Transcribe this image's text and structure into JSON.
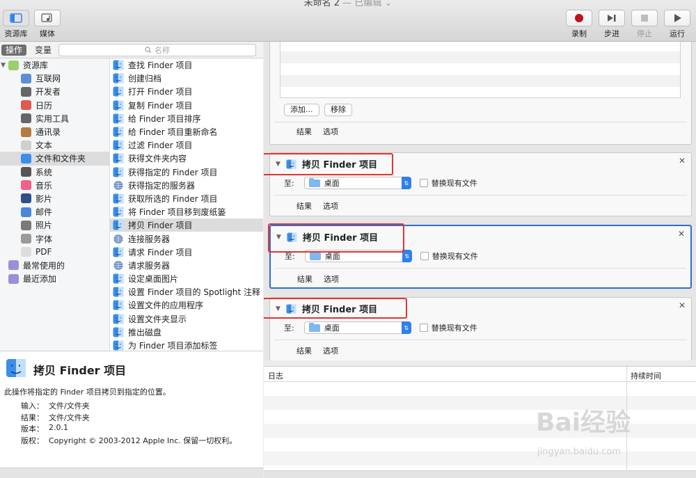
{
  "window": {
    "title": "未命名 2",
    "edited": "— 已编辑",
    "dropdown": "⌄"
  },
  "toolbar": {
    "library_label": "资源库",
    "media_label": "媒体",
    "record_label": "录制",
    "step_label": "步进",
    "stop_label": "停止",
    "run_label": "运行"
  },
  "left": {
    "tab_actions": "操作",
    "tab_variables": "变量",
    "search_placeholder": "名称"
  },
  "library": [
    {
      "label": "资源库",
      "icon": "library-icon",
      "color": "#9ad06a",
      "indent": 0,
      "disclosure": "▼"
    },
    {
      "label": "互联网",
      "icon": "globe-icon",
      "color": "#5b8fd6",
      "indent": 1
    },
    {
      "label": "开发者",
      "icon": "tools-icon",
      "color": "#666666",
      "indent": 1
    },
    {
      "label": "日历",
      "icon": "calendar-icon",
      "color": "#e05a4f",
      "indent": 1
    },
    {
      "label": "实用工具",
      "icon": "utilities-icon",
      "color": "#666666",
      "indent": 1
    },
    {
      "label": "通讯录",
      "icon": "contacts-icon",
      "color": "#b57b3e",
      "indent": 1
    },
    {
      "label": "文本",
      "icon": "text-icon",
      "color": "#cfcfcf",
      "indent": 1
    },
    {
      "label": "文件和文件夹",
      "icon": "finder-icon",
      "color": "#3c8ee8",
      "indent": 1,
      "selected": true
    },
    {
      "label": "系统",
      "icon": "system-icon",
      "color": "#555555",
      "indent": 1
    },
    {
      "label": "音乐",
      "icon": "music-icon",
      "color": "#f0608a",
      "indent": 1
    },
    {
      "label": "影片",
      "icon": "movie-icon",
      "color": "#2f4f8a",
      "indent": 1
    },
    {
      "label": "邮件",
      "icon": "mail-icon",
      "color": "#4a86d8",
      "indent": 1
    },
    {
      "label": "照片",
      "icon": "photos-icon",
      "color": "#7a7a7a",
      "indent": 1
    },
    {
      "label": "字体",
      "icon": "font-icon",
      "color": "#9a9a9a",
      "indent": 1
    },
    {
      "label": "PDF",
      "icon": "pdf-icon",
      "color": "#dddddd",
      "indent": 1
    },
    {
      "label": "最常使用的",
      "icon": "smart-folder-icon",
      "color": "#9c8fd8",
      "indent": 0
    },
    {
      "label": "最近添加",
      "icon": "smart-folder-icon",
      "color": "#9c8fd8",
      "indent": 0
    }
  ],
  "actions": [
    {
      "label": "查找 Finder 项目",
      "icon": "finder"
    },
    {
      "label": "创建归档",
      "icon": "finder"
    },
    {
      "label": "打开 Finder 项目",
      "icon": "finder"
    },
    {
      "label": "复制 Finder 项目",
      "icon": "finder"
    },
    {
      "label": "给 Finder 项目排序",
      "icon": "finder"
    },
    {
      "label": "给 Finder 项目重新命名",
      "icon": "finder"
    },
    {
      "label": "过滤 Finder 项目",
      "icon": "finder"
    },
    {
      "label": "获得文件夹内容",
      "icon": "finder"
    },
    {
      "label": "获得指定的 Finder 项目",
      "icon": "finder"
    },
    {
      "label": "获得指定的服务器",
      "icon": "globe"
    },
    {
      "label": "获取所选的 Finder 项目",
      "icon": "finder"
    },
    {
      "label": "将 Finder 项目移到废纸篓",
      "icon": "finder"
    },
    {
      "label": "拷贝 Finder 项目",
      "icon": "finder",
      "selected": true
    },
    {
      "label": "连接服务器",
      "icon": "globe"
    },
    {
      "label": "请求 Finder 项目",
      "icon": "finder"
    },
    {
      "label": "请求服务器",
      "icon": "globe"
    },
    {
      "label": "设定桌面图片",
      "icon": "finder"
    },
    {
      "label": "设置 Finder 项目的 Spotlight 注释",
      "icon": "finder"
    },
    {
      "label": "设置文件的应用程序",
      "icon": "finder"
    },
    {
      "label": "设置文件夹显示",
      "icon": "finder"
    },
    {
      "label": "推出磁盘",
      "icon": "finder"
    },
    {
      "label": "为 Finder 项目添加标签",
      "icon": "finder"
    }
  ],
  "description": {
    "title": "拷贝 Finder 项目",
    "summary": "此操作将指定的 Finder 项目拷贝到指定的位置。",
    "rows": [
      {
        "k": "输入：",
        "v": "文件/文件夹"
      },
      {
        "k": "结果：",
        "v": "文件/文件夹"
      },
      {
        "k": "版本：",
        "v": "2.0.1"
      },
      {
        "k": "版权：",
        "v": "Copyright © 2003-2012 Apple Inc. 保留一切权利。"
      }
    ]
  },
  "workflow": {
    "top_card": {
      "add_button": "添加...",
      "remove_button": "移除",
      "results": "结果",
      "options": "选项"
    },
    "cards": [
      {
        "title": "拷贝 Finder 项目",
        "to_label": "至:",
        "destination": "桌面",
        "replace_label": "替换现有文件",
        "results": "结果",
        "options": "选项",
        "selected": false
      },
      {
        "title": "拷贝 Finder 项目",
        "to_label": "至:",
        "destination": "桌面",
        "replace_label": "替换现有文件",
        "results": "结果",
        "options": "选项",
        "selected": true
      },
      {
        "title": "拷贝 Finder 项目",
        "to_label": "至:",
        "destination": "桌面",
        "replace_label": "替换现有文件",
        "results": "结果",
        "options": "选项",
        "selected": false
      }
    ]
  },
  "log": {
    "col_log": "日志",
    "col_duration": "持续时间"
  },
  "watermark": {
    "text": "Bai经验",
    "url": "jingyan.baidu.com"
  },
  "colors": {
    "accent": "#2f6fc9",
    "highlight": "#e03434",
    "record": "#c4101c"
  }
}
